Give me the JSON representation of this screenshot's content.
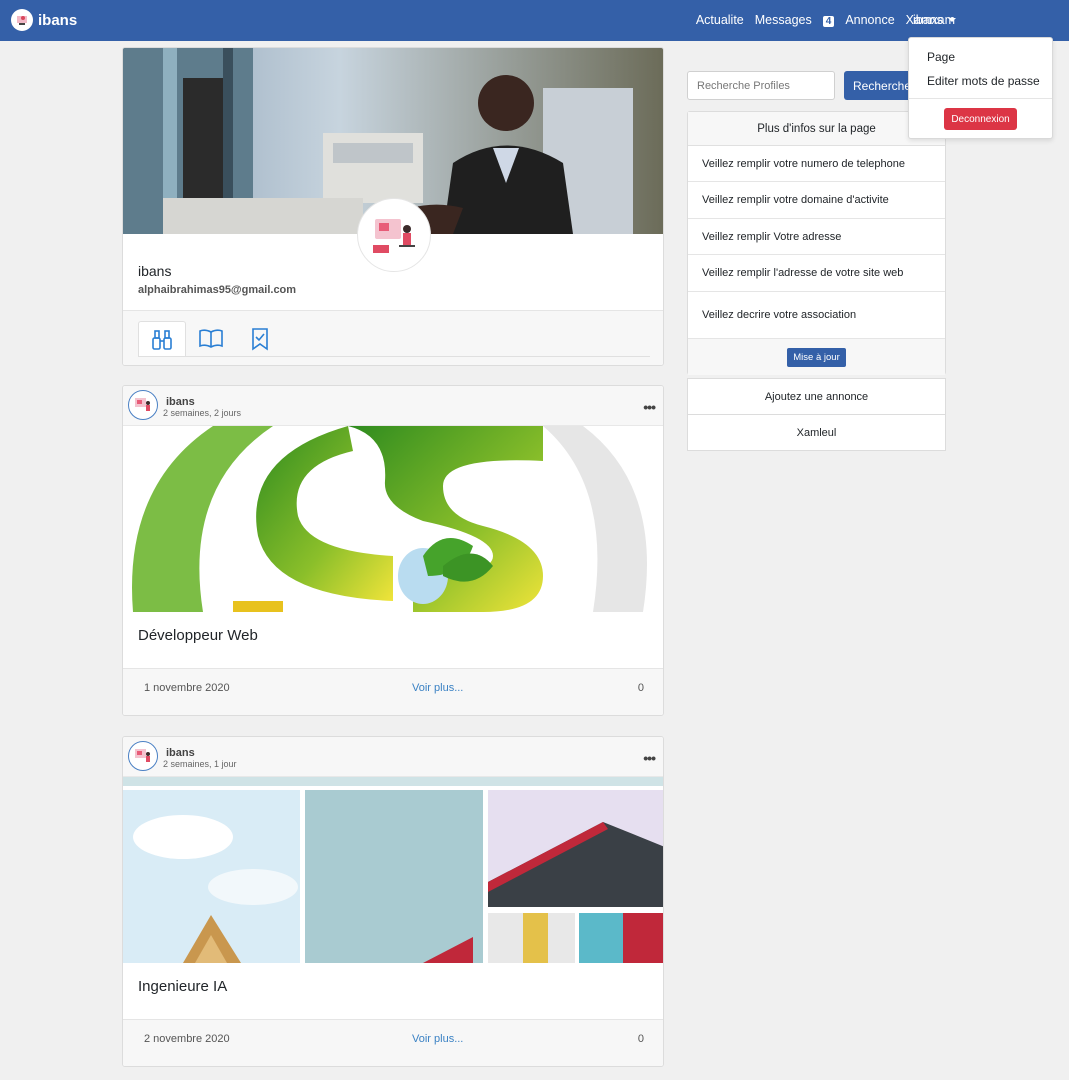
{
  "navbar": {
    "brand": "ibans",
    "links": [
      "Actualite",
      "Messages",
      "Annonce",
      "Xamxam"
    ],
    "messages_badge": "4",
    "user": "ibans",
    "bg_color": "#3460a8"
  },
  "dropdown": {
    "items": [
      "Page",
      "Editer mots de passe"
    ],
    "logout": "Deconnexion",
    "logout_color": "#dc3545"
  },
  "profile": {
    "name": "ibans",
    "email": "alphaibrahimas95@gmail.com",
    "tabs": [
      "binoculars-icon",
      "book-icon",
      "bookmark-check-icon"
    ]
  },
  "posts": [
    {
      "author": "ibans",
      "time": "2 semaines, 2 jours",
      "title": "Développeur Web",
      "date": "1 novembre 2020",
      "more": "Voir plus...",
      "count": "0"
    },
    {
      "author": "ibans",
      "time": "2 semaines, 1 jour",
      "title": "Ingenieure IA",
      "date": "2 novembre 2020",
      "more": "Voir plus...",
      "count": "0"
    }
  ],
  "sidebar": {
    "search_placeholder": "Recherche Profiles",
    "search_button": "Recherche",
    "info_title": "Plus d'infos sur la page",
    "info_items": [
      "Veillez remplir votre numero de telephone",
      "Veillez remplir votre domaine d'activite",
      "Veillez remplir Votre adresse",
      "Veillez remplir l'adresse de votre site web",
      "Veillez decrire votre association"
    ],
    "update_button": "Mise à jour",
    "add_announce": "Ajoutez une annonce",
    "xamleul": "Xamleul"
  }
}
